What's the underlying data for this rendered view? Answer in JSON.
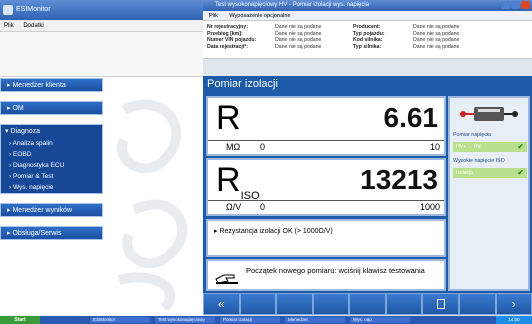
{
  "left_window": {
    "title": "ESIMonitor",
    "menu": [
      "Plik",
      "Dodatki"
    ],
    "nav": {
      "items_top": [
        {
          "label": "Menedżer klienta"
        },
        {
          "label": "OM"
        }
      ],
      "group": {
        "title": "Diagnoza",
        "items": [
          "Analiza spalin",
          "EOBD",
          "Diagnostyka ECU",
          "Pomiar & Test",
          "Wys. napięcie"
        ]
      },
      "items_bottom": [
        {
          "label": "Menedżer wyników"
        },
        {
          "label": "Obsługa/Serwis"
        }
      ]
    }
  },
  "right_window": {
    "title": "Test wysokonapięciowy HV - Pomiar izolacji wys. napięcia",
    "menu": [
      "Plik",
      "Wyposażenie opcjonalne"
    ],
    "vehicle_info": {
      "left_labels": [
        "Nr rejestracyjny:",
        "Przebieg [km]:",
        "Numer VIN pojazdu:",
        "Data rejestracji*:"
      ],
      "left_values": [
        "Dane nie są podane",
        "Dane nie są podane",
        "Dane nie są podane",
        "Dane nie są podane"
      ],
      "right_labels": [
        "Producent:",
        "Typ pojazdu:",
        "Kod silnika:",
        "Typ silnika:"
      ],
      "right_values": [
        "Dane nie są podane",
        "Dane nie są podane",
        "Dane nie są podane",
        "Dane nie są podane"
      ]
    },
    "screen_title": "Pomiar izolacji",
    "r_meter": {
      "symbol": "R",
      "unit": "MΩ",
      "min": "0",
      "max": "10",
      "value": "6.61"
    },
    "riso_meter": {
      "symbol": "R",
      "subscript": "ISO",
      "unit": "Ω/V",
      "min": "0",
      "max": "1000",
      "value": "13213"
    },
    "result_text": "Rezystancja izolacji OK (> 1000Ω/V)",
    "hint_text": "Początek nowego pomiaru: wciśnij klawisz testowania",
    "side_panel": {
      "section1": "Pomiar napięcia",
      "hv_label": "HV+ → HV-",
      "section2": "Wysokie napięcie ISO",
      "iso_label": "Izolacja"
    },
    "toolbar": {
      "back": "«",
      "next": "›"
    }
  },
  "taskbar": {
    "start": "Start",
    "tasks": [
      "ESIMonitor",
      "Test wysokonapięciowy",
      "Pomiar izolacji",
      "Menedżer",
      "Wys. nap."
    ],
    "tray_time": "14:00"
  },
  "colors": {
    "accent_blue": "#1d5aa8",
    "ok_green": "#b9e08c",
    "title_blue": "#2f62b3"
  }
}
